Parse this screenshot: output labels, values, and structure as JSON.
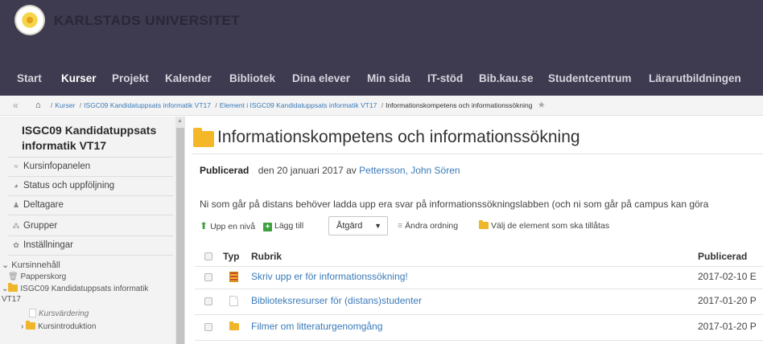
{
  "header": {
    "university_name": "KARLSTADS UNIVERSITET",
    "nav": [
      "Start",
      "Kurser",
      "Projekt",
      "Kalender",
      "Bibliotek",
      "Dina elever",
      "Min sida",
      "IT-stöd",
      "Bib.kau.se",
      "Studentcentrum",
      "Lärarutbildningen"
    ],
    "active_nav": "Kurser"
  },
  "breadcrumb": {
    "items": [
      "Kurser",
      "ISGC09 Kandidatuppsats informatik VT17",
      "Element i ISGC09 Kandidatuppsats informatik VT17"
    ],
    "current": "Informationskompetens och informationssökning"
  },
  "sidebar": {
    "course_title": "ISGC09 Kandidatuppsats informatik VT17",
    "items": [
      "Kursinfopanelen",
      "Status och uppföljning",
      "Deltagare",
      "Grupper",
      "Inställningar"
    ],
    "section": "Kursinnehåll",
    "tree": {
      "trash": "Papperskorg",
      "course_folder": "ISGC09 Kandidatuppsats informatik",
      "course_folder_cont": "VT17",
      "evaluation": "Kursvärdering",
      "intro": "Kursintroduktion"
    }
  },
  "main": {
    "title": "Informationskompetens och informationssökning",
    "published_label": "Publicerad",
    "published_date": "den 20 januari 2017 av",
    "author": "Pettersson, John Sören",
    "description": "Ni som går på distans behöver ladda upp era svar på informationssökningslabben (och ni som går på campus kan göra",
    "toolbar": {
      "up": "Upp en nivå",
      "add": "Lägg till",
      "action": "Åtgärd",
      "reorder": "Ändra ordning",
      "choose": "Välj de element som ska tillåtas"
    },
    "table": {
      "headers": {
        "type": "Typ",
        "title": "Rubrik",
        "published": "Publicerad"
      },
      "rows": [
        {
          "type": "assignment",
          "title": "Skriv upp er för informationssökning!",
          "published": "2017-02-10 E"
        },
        {
          "type": "document",
          "title": "Biblioteksresurser för (distans)studenter",
          "published": "2017-01-20 P"
        },
        {
          "type": "folder",
          "title": "Filmer om litteraturgenomgång",
          "published": "2017-01-20 P"
        }
      ]
    }
  },
  "colors": {
    "header_bg": "#3e3a4f",
    "link": "#3a7ab8",
    "folder": "#f4b728",
    "add_green": "#3ea03e"
  }
}
